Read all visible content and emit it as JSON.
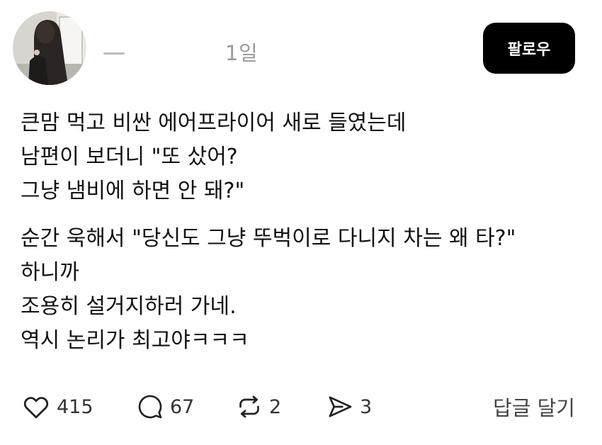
{
  "post": {
    "timestamp": "1일",
    "follow_label": "팔로우",
    "body": [
      [
        "큰맘 먹고 비싼 에어프라이어 새로 들였는데",
        "남편이 보더니 \"또 샀어?",
        "그냥 냄비에 하면 안 돼?\""
      ],
      [
        "순간 욱해서 \"당신도 그냥 뚜벅이로 다니지 차는 왜 타?\"",
        "하니까",
        "조용히 설거지하러 가네.",
        "역시 논리가 최고야ㅋㅋㅋ"
      ]
    ]
  },
  "actions": {
    "like_count": "415",
    "comment_count": "67",
    "repost_count": "2",
    "share_count": "3",
    "reply_label": "답글 달기"
  },
  "icons": {
    "like": "heart-icon",
    "comment": "speech-bubble-icon",
    "repost": "repost-arrows-icon",
    "share": "send-icon"
  },
  "colors": {
    "follow_button_bg": "#000000",
    "follow_button_text": "#ffffff",
    "timestamp": "#9a9a9a",
    "body_text": "#111111"
  }
}
